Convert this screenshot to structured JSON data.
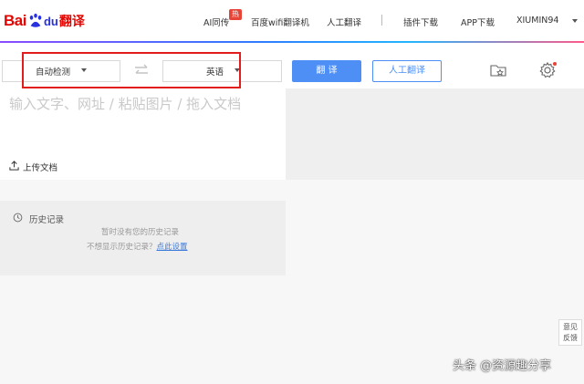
{
  "logo": {
    "bai": "Bai",
    "du": "du",
    "product": "翻译"
  },
  "nav": {
    "ai_interp": "AI同传",
    "hot_badge": "热",
    "wifi": "百度wifi翻译机",
    "human": "人工翻译",
    "plugin": "插件下载",
    "app": "APP下载",
    "user": "XIUMIN94"
  },
  "lang": {
    "source": "自动检测",
    "target": "英语"
  },
  "buttons": {
    "translate": "翻 译",
    "human_translate": "人工翻译"
  },
  "input": {
    "placeholder": "输入文字、网址 / 粘贴图片 / 拖入文档"
  },
  "upload": {
    "label": "上传文档"
  },
  "history": {
    "title": "历史记录",
    "empty": "暂时没有您的历史记录",
    "hint": "不想显示历史记录？",
    "link": "点此设置"
  },
  "feedback": {
    "line1": "意见",
    "line2": "反馈"
  },
  "watermark": "头条 @资源趣分享",
  "colors": {
    "brand_red": "#e10602",
    "brand_blue": "#2932e1",
    "primary": "#4e8ff6",
    "highlight_frame": "#e21b1b"
  }
}
